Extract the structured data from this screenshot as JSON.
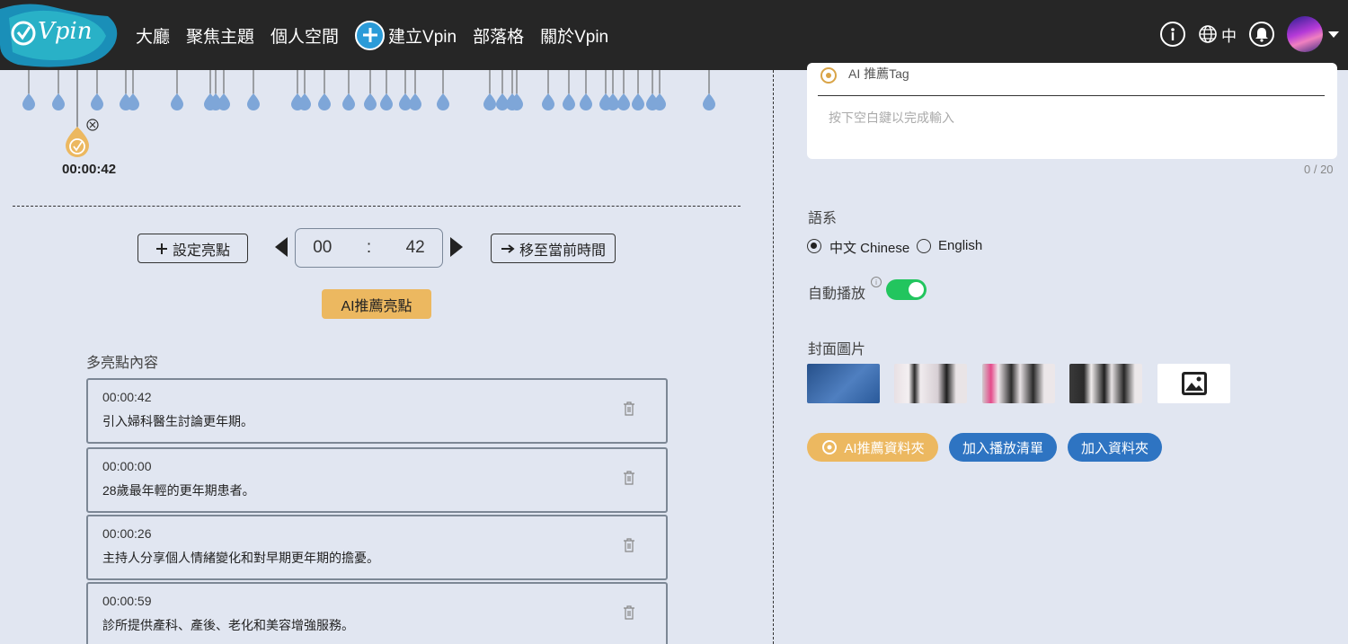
{
  "header": {
    "logo_text": "Vpin",
    "nav": [
      "大廳",
      "聚焦主題",
      "個人空間",
      "建立Vpin",
      "部落格",
      "關於Vpin"
    ],
    "lang": "中"
  },
  "timeline": {
    "current_time": "00:00:42"
  },
  "controls": {
    "set_highlight": "設定亮點",
    "minutes": "00",
    "colon": ":",
    "seconds": "42",
    "move_to_current": "移至當前時間",
    "ai_recommend": "AI推薦亮點"
  },
  "highlights": {
    "title": "多亮點內容",
    "items": [
      {
        "time": "00:00:42",
        "text": "引入婦科醫生討論更年期。"
      },
      {
        "time": "00:00:00",
        "text": "28歲最年輕的更年期患者。"
      },
      {
        "time": "00:00:26",
        "text": "主持人分享個人情緒變化和對早期更年期的擔憂。"
      },
      {
        "time": "00:00:59",
        "text": "診所提供產科、產後、老化和美容增強服務。"
      }
    ]
  },
  "tags": {
    "label": "AI 推薦Tag",
    "placeholder": "按下空白鍵以完成輸入",
    "counter": "0 / 20"
  },
  "language": {
    "title": "語系",
    "option_zh": "中文 Chinese",
    "option_en": "English",
    "selected": "中文 Chinese"
  },
  "autoplay": {
    "label": "自動播放",
    "info": "i",
    "enabled": true
  },
  "cover": {
    "title": "封面圖片"
  },
  "actions": {
    "ai_folder": "AI推薦資料夾",
    "add_playlist": "加入播放清單",
    "add_folder": "加入資料夾"
  },
  "colors": {
    "accent_orange": "#ecb860",
    "accent_blue": "#2e74c2",
    "toggle_green": "#22c55e",
    "pin_blue": "#7ea6d8"
  }
}
